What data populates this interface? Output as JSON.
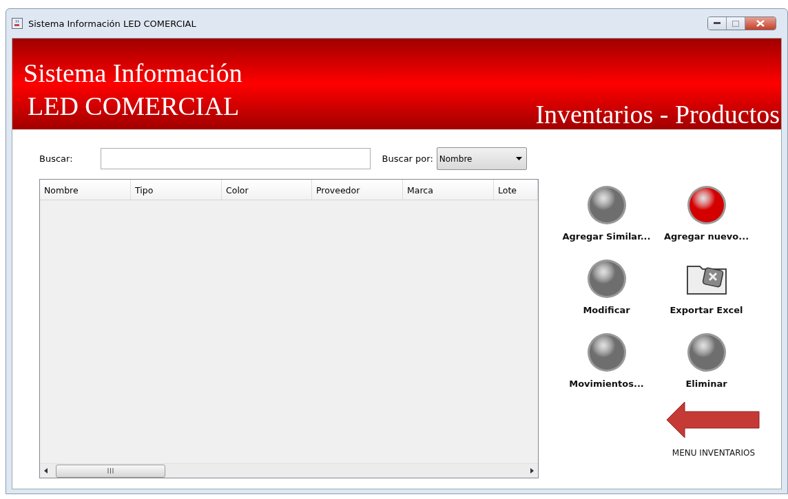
{
  "window": {
    "title": "Sistema Información LED COMERCIAL"
  },
  "banner": {
    "title_lines": [
      "Sistema Información",
      "LED COMERCIAL"
    ],
    "section": "Inventarios - Productos"
  },
  "search": {
    "label": "Buscar:",
    "by_label": "Buscar por:",
    "by_value": "Nombre"
  },
  "table": {
    "columns": [
      "Nombre",
      "Tipo",
      "Color",
      "Proveedor",
      "Marca",
      "Lote"
    ]
  },
  "actions": [
    {
      "label": "Agregar Similar...",
      "kind": "orb",
      "color": "#6e6e6e"
    },
    {
      "label": "Agregar nuevo...",
      "kind": "orb",
      "color": "#d40000"
    },
    {
      "label": "Modificar",
      "kind": "orb",
      "color": "#6e6e6e"
    },
    {
      "label": "Exportar Excel",
      "kind": "folder"
    },
    {
      "label": "Movimientos...",
      "kind": "orb",
      "color": "#6e6e6e"
    },
    {
      "label": "Eliminar",
      "kind": "orb",
      "color": "#6e6e6e"
    }
  ],
  "back": {
    "label": "MENU INVENTARIOS"
  }
}
